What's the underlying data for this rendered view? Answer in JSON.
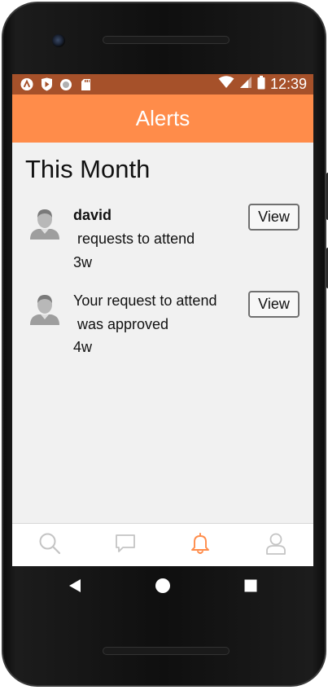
{
  "status_bar": {
    "time": "12:39",
    "left_icons": [
      "android-a-icon",
      "play-shield-icon",
      "circle-icon",
      "sd-card-icon"
    ],
    "right_icons": [
      "wifi-icon",
      "signal-icon",
      "battery-icon"
    ]
  },
  "header": {
    "title": "Alerts"
  },
  "section": {
    "title": "This Month"
  },
  "alerts": [
    {
      "name": "david",
      "line1": " requests to attend",
      "age": "3w",
      "button": "View",
      "avatar": "person-avatar-icon"
    },
    {
      "line1": "Your request to attend",
      "line2": " was approved",
      "age": "4w",
      "button": "View",
      "avatar": "person-avatar-icon"
    }
  ],
  "bottom_nav": {
    "items": [
      {
        "icon": "search-icon",
        "active": false
      },
      {
        "icon": "chat-icon",
        "active": false
      },
      {
        "icon": "bell-icon",
        "active": true
      },
      {
        "icon": "user-icon",
        "active": false
      }
    ]
  },
  "colors": {
    "accent": "#ff8c4a",
    "status_bar": "#a6512a",
    "inactive_icon": "#c4c4c4"
  },
  "system_nav": {
    "icons": [
      "back-icon",
      "home-icon",
      "recents-icon"
    ]
  }
}
